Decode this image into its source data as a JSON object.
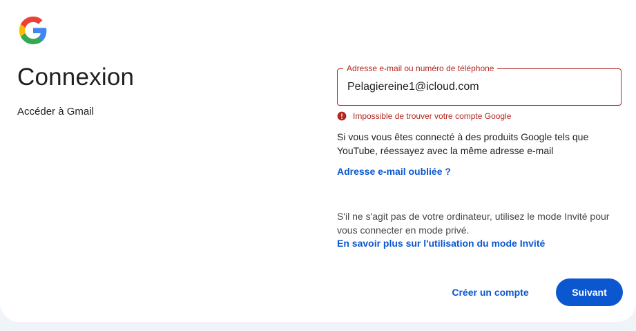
{
  "header": {
    "logo_icon": "google-g-logo",
    "title": "Connexion",
    "subtitle": "Accéder à Gmail"
  },
  "form": {
    "email_label": "Adresse e-mail ou numéro de téléphone",
    "email_value": "Pelagiereine1@icloud.com",
    "error_icon": "error-circle-icon",
    "error_text": "Impossible de trouver votre compte Google",
    "info_text": "Si vous vous êtes connecté à des produits Google tels que YouTube, réessayez avec la même adresse e-mail",
    "forgot_link": "Adresse e-mail oubliée ?"
  },
  "guest": {
    "text": "S'il ne s'agit pas de votre ordinateur, utilisez le mode Invité pour vous connecter en mode privé.",
    "link": "En savoir plus sur l'utilisation du mode Invité"
  },
  "actions": {
    "create_account": "Créer un compte",
    "next": "Suivant"
  },
  "colors": {
    "accent": "#0b57d0",
    "error": "#b3261e",
    "background": "#f0f4f9"
  }
}
